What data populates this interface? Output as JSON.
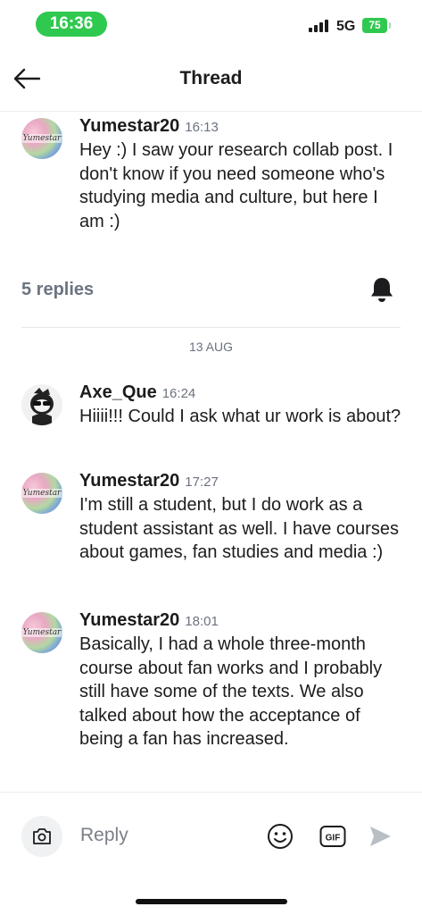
{
  "status": {
    "time": "16:36",
    "network": "5G",
    "battery": "75"
  },
  "header": {
    "title": "Thread"
  },
  "parent_message": {
    "username": "Yumestar20",
    "time": "16:13",
    "text": "Hey :) I saw your research collab post. I don't know if you need someone who's studying media and culture, but here I am :)",
    "avatar_watermark": "Yumestar"
  },
  "thread": {
    "replies_label": "5 replies",
    "date": "13 AUG"
  },
  "replies": [
    {
      "username": "Axe_Que",
      "time": "16:24",
      "text": "Hiiii!!! Could I ask what ur work is about?"
    },
    {
      "username": "Yumestar20",
      "time": "17:27",
      "text": "I'm still a student, but I do work as a student assistant as well. I have courses about games, fan studies and media :)",
      "avatar_watermark": "Yumestar"
    },
    {
      "username": "Yumestar20",
      "time": "18:01",
      "text": "Basically, I had a whole three-month course about fan works and I probably still have some of the texts. We also talked about how the acceptance of being a fan has increased.",
      "avatar_watermark": "Yumestar"
    }
  ],
  "composer": {
    "placeholder": "Reply",
    "gif_label": "GIF"
  },
  "colors": {
    "status_green": "#2fc94f",
    "muted_text": "#6b7581"
  }
}
